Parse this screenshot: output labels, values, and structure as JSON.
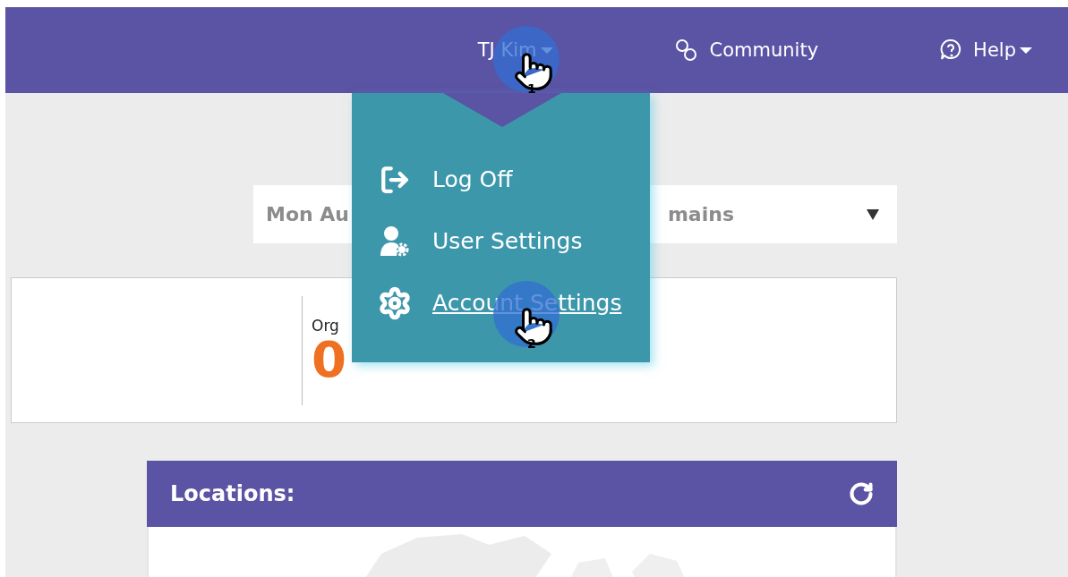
{
  "header": {
    "user_menu": {
      "label": "TJ Kim",
      "expanded": true
    },
    "links": [
      {
        "kind": "community",
        "label": "Community",
        "caret": false
      },
      {
        "kind": "help",
        "label": "Help",
        "caret": true
      }
    ]
  },
  "user_dropdown": {
    "items": [
      {
        "kind": "logoff",
        "label": "Log Off",
        "hovered": false
      },
      {
        "kind": "user",
        "label": "User Settings",
        "hovered": false
      },
      {
        "kind": "account",
        "label": "Account Settings",
        "hovered": true
      }
    ]
  },
  "step_markers": [
    {
      "number": "1"
    },
    {
      "number": "2"
    }
  ],
  "filter_select": {
    "visible_start": "Mon Au",
    "visible_end": "mains"
  },
  "stats_card": {
    "label": "Org",
    "value": "0"
  },
  "locations_panel": {
    "title": "Locations:"
  }
}
